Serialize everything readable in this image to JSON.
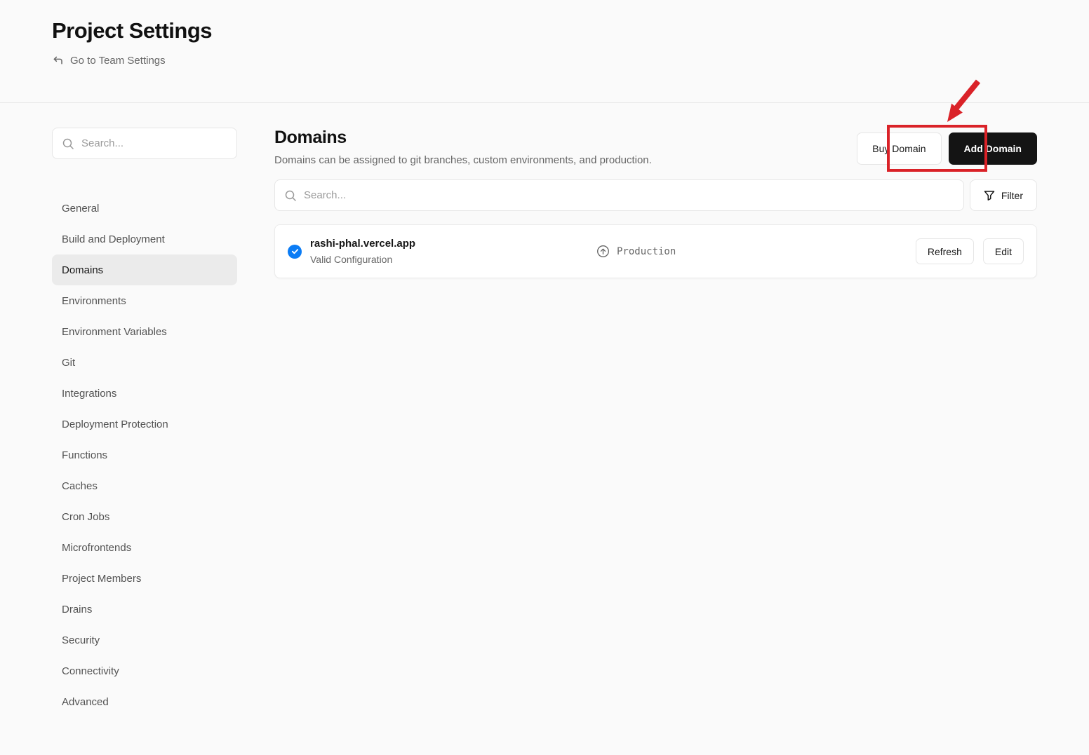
{
  "page": {
    "title": "Project Settings",
    "back_link_label": "Go to Team Settings"
  },
  "sidebar": {
    "search_placeholder": "Search...",
    "items": [
      "General",
      "Build and Deployment",
      "Domains",
      "Environments",
      "Environment Variables",
      "Git",
      "Integrations",
      "Deployment Protection",
      "Functions",
      "Caches",
      "Cron Jobs",
      "Microfrontends",
      "Project Members",
      "Drains",
      "Security",
      "Connectivity",
      "Advanced"
    ],
    "selected_item": "Domains"
  },
  "main": {
    "title": "Domains",
    "description": "Domains can be assigned to git branches, custom environments, and production.",
    "buy_button_label": "Buy Domain",
    "add_button_label": "Add Domain",
    "search_placeholder": "Search...",
    "filter_label": "Filter",
    "domain": {
      "name": "rashi-phal.vercel.app",
      "status": "Valid Configuration",
      "environment": "Production",
      "refresh_label": "Refresh",
      "edit_label": "Edit"
    }
  },
  "colors": {
    "valid_check_blue": "#0b7cf5",
    "annotation_red": "#da2228",
    "add_button_black": "#141414",
    "page_background": "#fafafa"
  },
  "icons": {
    "back": "corner-up-left-icon",
    "search": "search-icon",
    "filter": "funnel-icon",
    "valid": "check-circle-icon",
    "environment": "arrow-up-circle-icon"
  }
}
